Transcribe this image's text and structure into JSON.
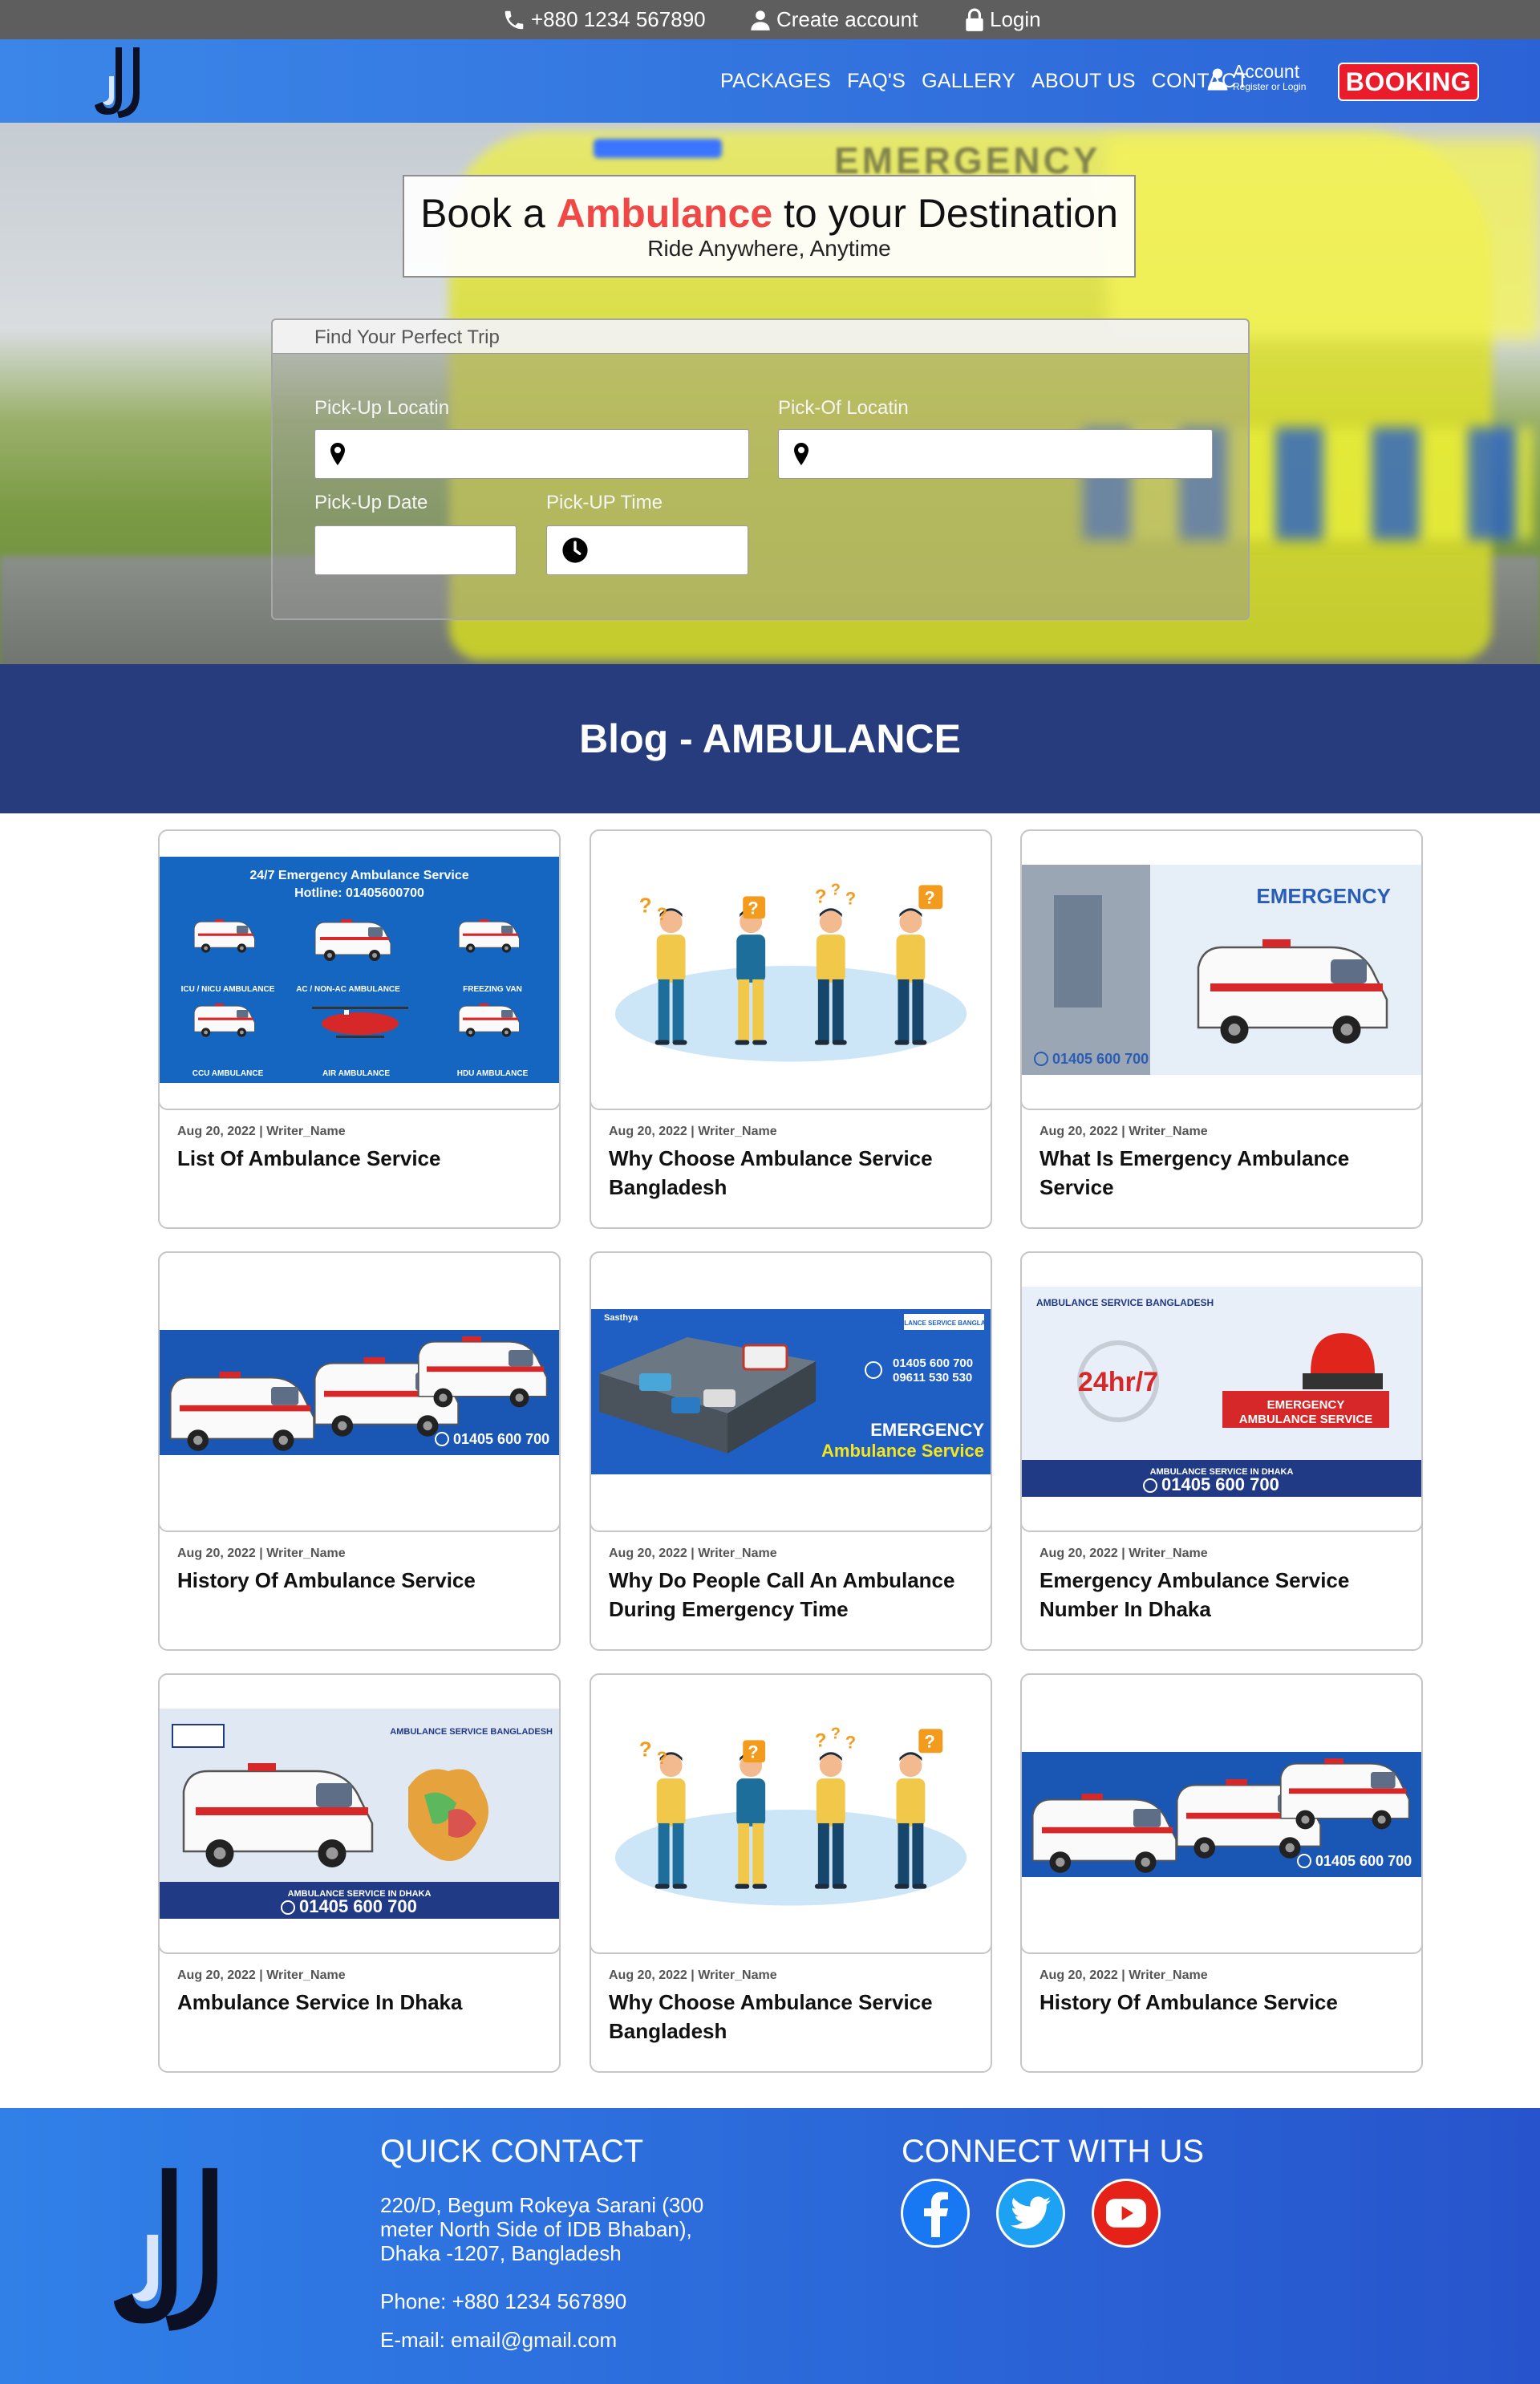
{
  "topbar": {
    "phone": "+880 1234 567890",
    "create_account": "Create account",
    "login": "Login"
  },
  "nav": {
    "items": [
      "PACKAGES",
      "FAQ'S",
      "GALLERY",
      "ABOUT US",
      "CONTACT"
    ],
    "account": "Account",
    "account_sub": "Register or Login",
    "booking": "BOOKING"
  },
  "hero": {
    "title_pre": "Book a ",
    "title_accent": "Ambulance",
    "title_post": " to your Destination",
    "subtitle": "Ride Anywhere, Anytime",
    "van_text": "EMERGENCY",
    "finder_title": "Find Your Perfect Trip",
    "pickup_location": "Pick-Up Locatin",
    "dropoff_location": "Pick-Of Locatin",
    "pickup_date": "Pick-Up Date",
    "pickup_time": "Pick-UP Time"
  },
  "blog": {
    "heading": "Blog - AMBULANCE",
    "posts": [
      {
        "meta": "Aug 20, 2022 | Writer_Name",
        "title": "List Of Ambulance Service",
        "image": "ambulance-fleet-banner"
      },
      {
        "meta": "Aug 20, 2022 | Writer_Name",
        "title": "Why Choose Ambulance Service Bangladesh",
        "image": "people-questions"
      },
      {
        "meta": "Aug 20, 2022 | Writer_Name",
        "title": "What Is Emergency Ambulance Service",
        "image": "emergency-ambulance"
      },
      {
        "meta": "Aug 20, 2022 | Writer_Name",
        "title": "History Of Ambulance Service",
        "image": "ambulance-row-banner"
      },
      {
        "meta": "Aug 20, 2022 | Writer_Name",
        "title": "Why Do People Call An Ambulance During Emergency Time",
        "image": "accident-scene"
      },
      {
        "meta": "Aug 20, 2022 | Writer_Name",
        "title": "Emergency Ambulance Service Number In Dhaka",
        "image": "siren-247"
      },
      {
        "meta": "Aug 20, 2022 | Writer_Name",
        "title": "Ambulance Service In Dhaka",
        "image": "ccu-ambulance-map"
      },
      {
        "meta": "Aug 20, 2022 | Writer_Name",
        "title": "Why Choose Ambulance Service Bangladesh",
        "image": "people-questions"
      },
      {
        "meta": "Aug 20, 2022 | Writer_Name",
        "title": "History Of Ambulance Service",
        "image": "ambulance-row-banner"
      }
    ],
    "img_text": {
      "fleet_head": "24/7 Emergency Ambulance Service",
      "fleet_hotline": "Hotline: 01405600700",
      "fleet_labels": [
        "ICU / NICU AMBULANCE",
        "AC / NON-AC AMBULANCE",
        "FREEZING VAN",
        "CCU AMBULANCE",
        "AIR AMBULANCE",
        "HDU AMBULANCE"
      ],
      "emergency": "EMERGENCY",
      "phone": "01405 600 700",
      "phone2": "09611 530 530",
      "service_bd": "AMBULANCE SERVICE BANGLADESH",
      "service_dhaka": "AMBULANCE SERVICE IN DHAKA",
      "em_amb_service": "EMERGENCY AMBULANCE SERVICE",
      "em_word": "EMERGENCY",
      "amb_service": "Ambulance Service",
      "brand": "Sasthya",
      "hr7": "24hr/7",
      "ccu": "CCU",
      "ambulance": "AMBULANCE"
    }
  },
  "footer": {
    "quick_contact": "QUICK CONTACT",
    "address": "220/D, Begum Rokeya Sarani (300 meter North Side of IDB Bhaban), Dhaka -1207, Bangladesh",
    "phone": "Phone: +880 1234 567890",
    "email": "E-mail: email@gmail.com",
    "connect": "CONNECT WITH US",
    "social": [
      "facebook-icon",
      "twitter-icon",
      "youtube-icon"
    ],
    "colors": {
      "facebook": "#1877f2",
      "twitter": "#1da1f2",
      "youtube": "#e62117"
    }
  }
}
